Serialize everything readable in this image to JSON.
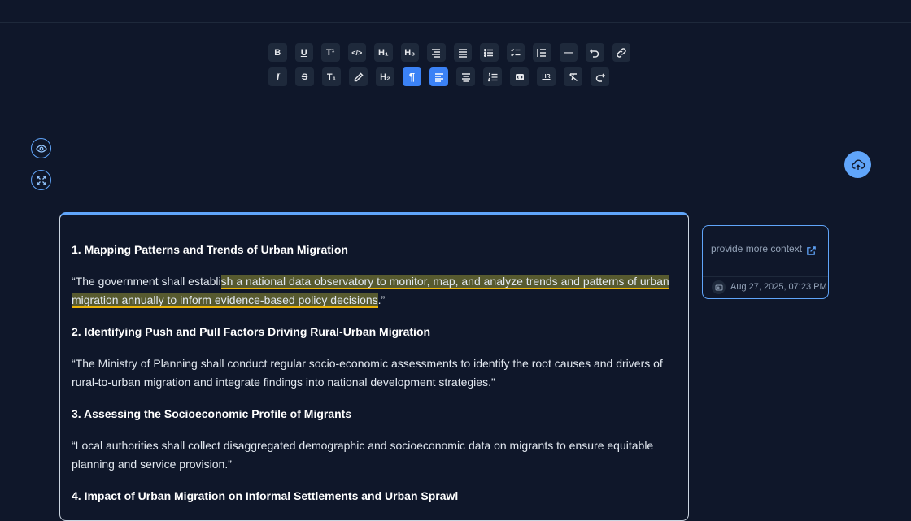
{
  "toolbar": {
    "row1": [
      {
        "name": "bold-button",
        "label": "B"
      },
      {
        "name": "underline-button",
        "label": "U"
      },
      {
        "name": "superscript-button",
        "label": "T¹"
      },
      {
        "name": "code-button",
        "label": "</>"
      },
      {
        "name": "heading1-button",
        "label": "H₁"
      },
      {
        "name": "heading3-button",
        "label": "H₃"
      },
      {
        "name": "align-right-button",
        "label": ""
      },
      {
        "name": "align-justify-button",
        "label": ""
      },
      {
        "name": "bullet-list-button",
        "label": ""
      },
      {
        "name": "task-list-button",
        "label": ""
      },
      {
        "name": "indent-button",
        "label": ""
      },
      {
        "name": "horizontal-rule-button",
        "label": "—"
      },
      {
        "name": "undo-button",
        "label": ""
      },
      {
        "name": "link-button",
        "label": ""
      }
    ],
    "row2": [
      {
        "name": "italic-button",
        "label": "I"
      },
      {
        "name": "strikethrough-button",
        "label": "S"
      },
      {
        "name": "subscript-button",
        "label": "T₁"
      },
      {
        "name": "highlight-button",
        "label": ""
      },
      {
        "name": "heading2-button",
        "label": "H₂"
      },
      {
        "name": "paragraph-button",
        "label": "¶",
        "active": true
      },
      {
        "name": "align-left-button",
        "label": "",
        "active": true
      },
      {
        "name": "align-center-button",
        "label": ""
      },
      {
        "name": "ordered-list-button",
        "label": ""
      },
      {
        "name": "code-block-button",
        "label": ""
      },
      {
        "name": "hard-break-button",
        "label": "HR"
      },
      {
        "name": "clear-format-button",
        "label": ""
      },
      {
        "name": "redo-button",
        "label": ""
      }
    ]
  },
  "document": {
    "sections": [
      {
        "heading": "1. Mapping Patterns and Trends of Urban Migration"
      },
      {
        "heading": "2. Identifying Push and Pull Factors Driving Rural-Urban Migration",
        "body": " “The Ministry of Planning shall conduct regular socio-economic assessments to identify the root causes and drivers of rural-to-urban migration and integrate findings into national development strategies.”"
      },
      {
        "heading": "3. Assessing the Socioeconomic Profile of Migrants",
        "body": " “Local authorities shall collect disaggregated demographic and socioeconomic data on migrants to ensure equitable planning and service provision.”"
      },
      {
        "heading": "4. Impact of Urban Migration on Informal Settlements and Urban Sprawl"
      }
    ],
    "para1": {
      "before": " “The government shall establi",
      "highlight": "sh a national data observatory to monitor, map, and analyze trends and patterns of urban migration annually to inform evidence-based policy decisions",
      "after": ".”"
    }
  },
  "comment": {
    "text": "provide more context",
    "timestamp": "Aug 27, 2025, 07:23 PM"
  },
  "colors": {
    "background": "#0f172a",
    "accent": "#3b82f6",
    "highlight": "#575a2f",
    "highlight_underline": "#eab308"
  }
}
